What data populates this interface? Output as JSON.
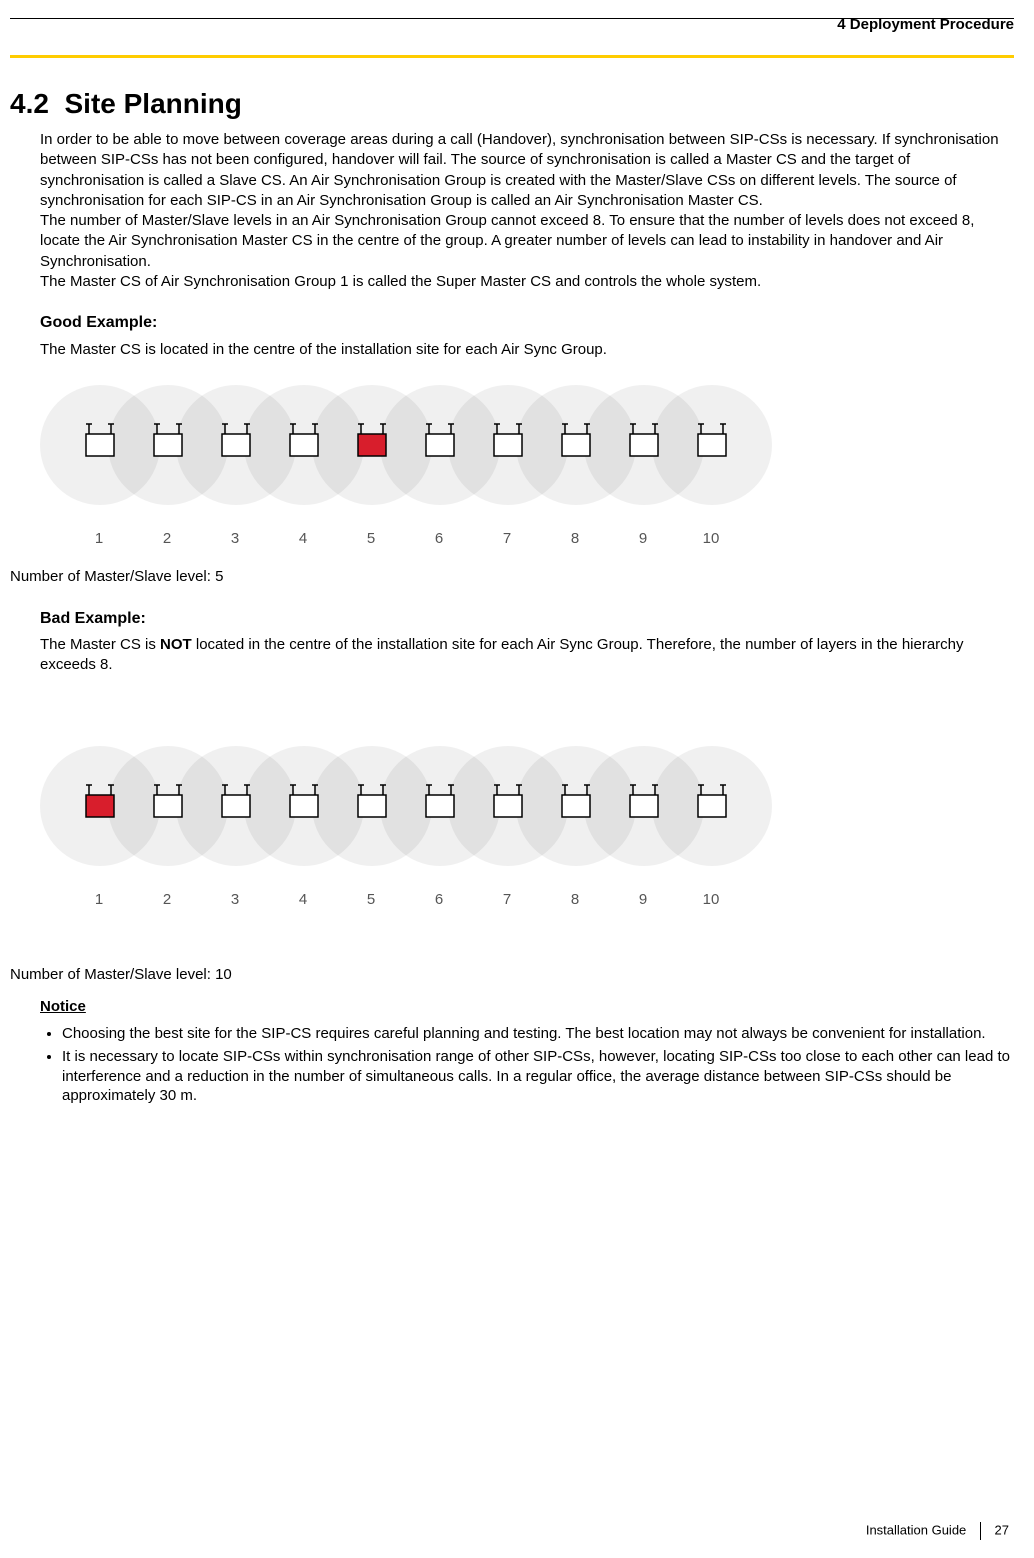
{
  "header": {
    "chapter": "4 Deployment Procedure"
  },
  "section": {
    "number": "4.2",
    "title": "Site Planning"
  },
  "intro": "In order to be able to move between coverage areas during a call (Handover), synchronisation between SIP-CSs is necessary. If synchronisation between SIP-CSs has not been configured, handover will fail. The source of synchronisation is called a Master CS and the target of synchronisation is called a Slave CS. An Air Synchronisation Group is created with the Master/Slave CSs on different levels. The source of synchronisation for each SIP-CS in an Air Synchronisation Group is called an Air Synchronisation Master CS.\nThe number of Master/Slave levels in an Air Synchronisation Group cannot exceed 8. To ensure that the number of levels does not exceed 8, locate the Air Synchronisation Master CS in the centre of the group. A greater number of levels can lead to instability in handover and Air Synchronisation.\nThe Master CS of Air Synchronisation Group 1 is called the Super Master CS and controls the whole system.",
  "good": {
    "heading": "Good Example:",
    "desc": "The Master CS is located in the centre of the installation site for each Air Sync Group.",
    "labels": [
      "1",
      "2",
      "3",
      "4",
      "5",
      "6",
      "7",
      "8",
      "9",
      "10"
    ],
    "master_index": 4,
    "level": "Number of Master/Slave level: 5"
  },
  "bad": {
    "heading": "Bad Example:",
    "desc_pre": "The Master CS is ",
    "desc_bold": "NOT",
    "desc_post": " located in the centre of the installation site for each Air Sync Group. Therefore, the number of layers in the hierarchy exceeds 8.",
    "labels": [
      "1",
      "2",
      "3",
      "4",
      "5",
      "6",
      "7",
      "8",
      "9",
      "10"
    ],
    "master_index": 0,
    "level": "Number of Master/Slave level: 10"
  },
  "notice": {
    "heading": "Notice",
    "items": [
      "Choosing the best site for the SIP-CS requires careful planning and testing. The best location may not always be convenient for installation.",
      "It is necessary to locate SIP-CSs within synchronisation range of other SIP-CSs, however, locating SIP-CSs too close to each other can lead to interference and a reduction in the number of simultaneous calls. In a regular office, the average distance between SIP-CSs should be approximately 30 m."
    ]
  },
  "footer": {
    "guide": "Installation Guide",
    "page": "27"
  },
  "colors": {
    "master_fill": "#d81e2c",
    "slave_fill": "#ffffff",
    "zone_fill": "#000000"
  }
}
